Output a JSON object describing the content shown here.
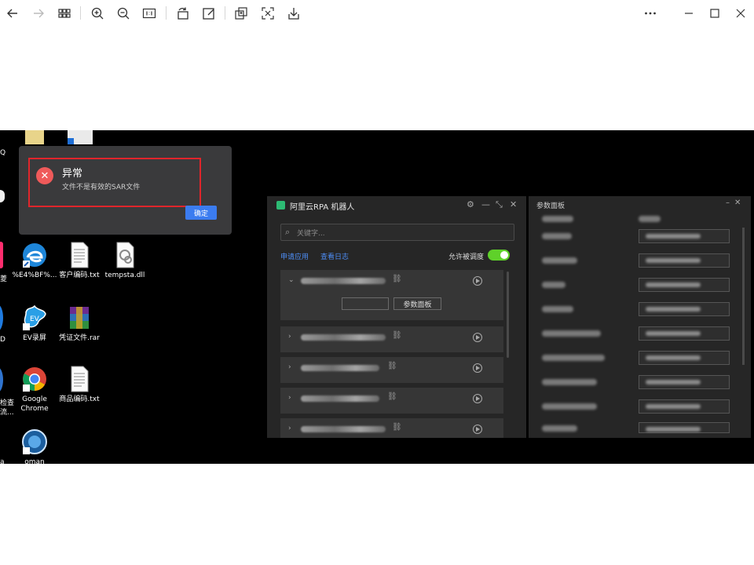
{
  "toolbar": {
    "buttons": [
      "back-icon",
      "forward-icon",
      "grid-icon",
      "zoom-in-icon",
      "zoom-out-icon",
      "actual-size-icon",
      "rotate-icon",
      "edit-icon",
      "copy-icon",
      "fit-icon",
      "download-icon",
      "more-icon",
      "minimize-icon",
      "maximize-icon",
      "close-icon"
    ]
  },
  "desktop": {
    "icons": [
      {
        "label": "%E4%BF%...",
        "icon": "edge-icon"
      },
      {
        "label": "客户编码.txt",
        "icon": "text-file-icon"
      },
      {
        "label": "tempsta.dll",
        "icon": "dll-file-icon"
      },
      {
        "label": "EV录屏",
        "icon": "ev-recorder-icon"
      },
      {
        "label": "凭证文件.rar",
        "icon": "rar-icon"
      },
      {
        "label": "Google Chrome",
        "icon": "chrome-icon"
      },
      {
        "label": "商品编码.txt",
        "icon": "text-file-icon"
      },
      {
        "label": "oman",
        "icon": "app-icon"
      }
    ],
    "left_edge_labels": [
      "Q",
      "菱",
      "D",
      "检查",
      "流...",
      "a"
    ]
  },
  "error_dialog": {
    "title": "异常",
    "message": "文件不是有效的SAR文件",
    "ok_label": "确定",
    "highlight_color": "#e0252b"
  },
  "rpa_window": {
    "title": "阿里云RPA 机器人",
    "search_placeholder": "关键字...",
    "link_apply": "申请应用",
    "link_log": "查看日志",
    "allow_schedule_label": "允许被调度",
    "allow_schedule_on": true,
    "toggle_color": "#5fd12a",
    "expanded_button_2": "参数面板"
  },
  "param_panel": {
    "title": "参数面板"
  }
}
